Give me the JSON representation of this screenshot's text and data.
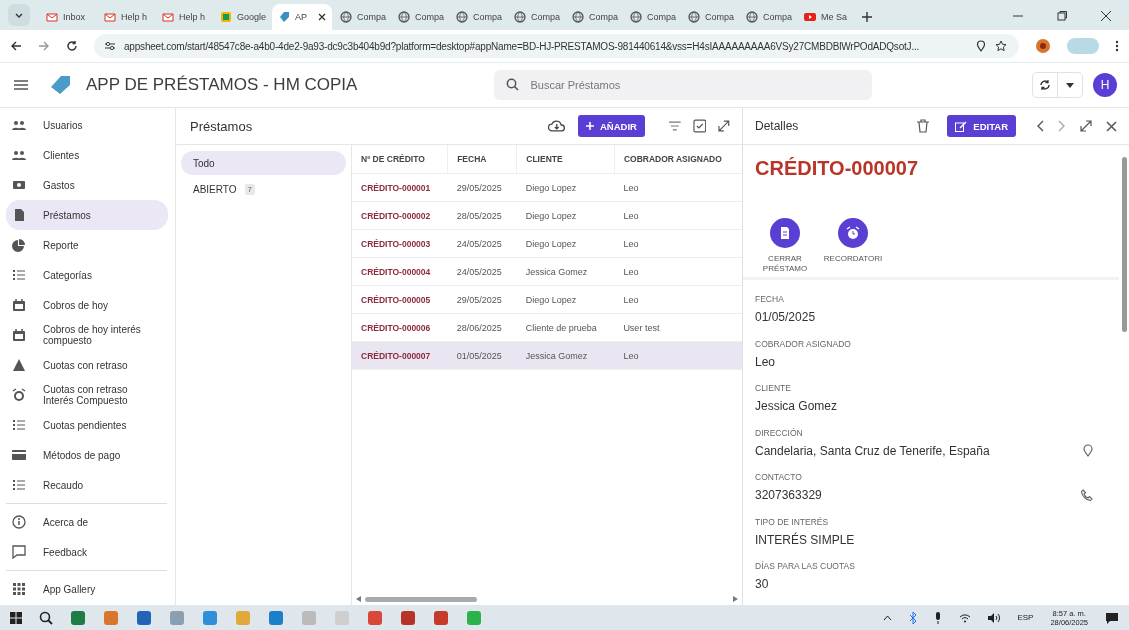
{
  "browser": {
    "tabs": [
      {
        "label": "Inbox",
        "kind": "mail",
        "selected": false
      },
      {
        "label": "Help h",
        "kind": "mail",
        "selected": false
      },
      {
        "label": "Help h",
        "kind": "mail",
        "selected": false
      },
      {
        "label": "Google",
        "kind": "doc",
        "selected": false
      },
      {
        "label": "AP",
        "kind": "app",
        "selected": true
      },
      {
        "label": "Compa",
        "kind": "globe",
        "selected": false
      },
      {
        "label": "Compa",
        "kind": "globe",
        "selected": false
      },
      {
        "label": "Compa",
        "kind": "globe",
        "selected": false
      },
      {
        "label": "Compa",
        "kind": "globe",
        "selected": false
      },
      {
        "label": "Compa",
        "kind": "globe",
        "selected": false
      },
      {
        "label": "Compa",
        "kind": "globe",
        "selected": false
      },
      {
        "label": "Compa",
        "kind": "globe",
        "selected": false
      },
      {
        "label": "Compa",
        "kind": "globe",
        "selected": false
      },
      {
        "label": "Me Sa",
        "kind": "video",
        "selected": false
      }
    ],
    "url": "appsheet.com/start/48547c8e-a4b0-4de2-9a93-dc9c3b404b9d?platform=desktop#appName=BD-HJ-PRESTAMOS-981440614&vss=H4sIAAAAAAAAA6VSy27CMBDBlWrPOdADQsotJ..."
  },
  "app": {
    "title": "APP DE PRÉSTAMOS - HM COPIA",
    "search": {
      "placeholder": "Buscar Préstamos"
    },
    "avatar": "H"
  },
  "sidebar": {
    "sections": [
      [
        {
          "label": "Usuarios",
          "selected": false
        },
        {
          "label": "Clientes",
          "selected": false
        },
        {
          "label": "Gastos",
          "selected": false
        },
        {
          "label": "Préstamos",
          "selected": true
        },
        {
          "label": "Reporte",
          "selected": false
        },
        {
          "label": "Categorías",
          "selected": false
        },
        {
          "label": "Cobros de hoy",
          "selected": false
        },
        {
          "label": "Cobros de hoy interés compuesto",
          "selected": false
        },
        {
          "label": "Cuotas con retraso",
          "selected": false
        },
        {
          "label": "Cuotas con retraso Interés Compuesto",
          "selected": false
        },
        {
          "label": "Cuotas pendientes",
          "selected": false
        },
        {
          "label": "Métodos de pago",
          "selected": false
        },
        {
          "label": "Recaudo",
          "selected": false
        }
      ],
      [
        {
          "label": "Acerca de",
          "selected": false
        },
        {
          "label": "Feedback",
          "selected": false
        }
      ],
      [
        {
          "label": "App Gallery",
          "selected": false
        }
      ]
    ]
  },
  "list": {
    "title": "Préstamos",
    "add_button": "AÑADIR",
    "filters": [
      {
        "label": "Todo",
        "selected": true
      },
      {
        "label": "ABIERTO",
        "count": "7",
        "selected": false
      }
    ]
  },
  "table": {
    "columns": [
      "Nº DE CRÉDITO",
      "FECHA",
      "CLIENTE",
      "COBRADOR ASIGNADO"
    ],
    "rows": [
      {
        "cells": [
          "CRÉDITO-000001",
          "29/05/2025",
          "Diego Lopez",
          "Leo"
        ],
        "selected": false
      },
      {
        "cells": [
          "CRÉDITO-000002",
          "28/05/2025",
          "Diego Lopez",
          "Leo"
        ],
        "selected": false
      },
      {
        "cells": [
          "CRÉDITO-000003",
          "24/05/2025",
          "Diego Lopez",
          "Leo"
        ],
        "selected": false
      },
      {
        "cells": [
          "CRÉDITO-000004",
          "24/05/2025",
          "Jessica Gomez",
          "Leo"
        ],
        "selected": false
      },
      {
        "cells": [
          "CRÉDITO-000005",
          "29/05/2025",
          "Diego Lopez",
          "Leo"
        ],
        "selected": false
      },
      {
        "cells": [
          "CRÉDITO-000006",
          "28/06/2025",
          "Cliente de prueba",
          "User test"
        ],
        "selected": false
      },
      {
        "cells": [
          "CRÉDITO-000007",
          "01/05/2025",
          "Jessica Gomez",
          "Leo"
        ],
        "selected": true
      }
    ]
  },
  "detail": {
    "header": "Detalles",
    "edit_button": "EDITAR",
    "title": "CRÉDITO-000007",
    "actions": [
      {
        "label": "CERRAR PRÉSTAMO",
        "kind": "document"
      },
      {
        "label": "RECORDATORI",
        "kind": "alarm"
      }
    ],
    "fields": [
      {
        "label": "FECHA",
        "value": "01/05/2025",
        "kind": "text"
      },
      {
        "label": "COBRADOR ASIGNADO",
        "value": "Leo",
        "kind": "text"
      },
      {
        "label": "CLIENTE",
        "value": "Jessica Gomez",
        "kind": "text"
      },
      {
        "label": "DIRECCIÓN",
        "value": "Candelaria, Santa Cruz de Tenerife, España",
        "kind": "address"
      },
      {
        "label": "CONTACTO",
        "value": "3207363329",
        "kind": "phone"
      },
      {
        "label": "TIPO DE INTERÉS",
        "value": "INTERÉS SIMPLE",
        "kind": "text"
      },
      {
        "label": "DÍAS PARA LAS CUOTAS",
        "value": "30",
        "kind": "text"
      }
    ]
  },
  "taskbar": {
    "language": "ESP",
    "time": "8:57 a. m.",
    "date": "28/06/2025"
  }
}
